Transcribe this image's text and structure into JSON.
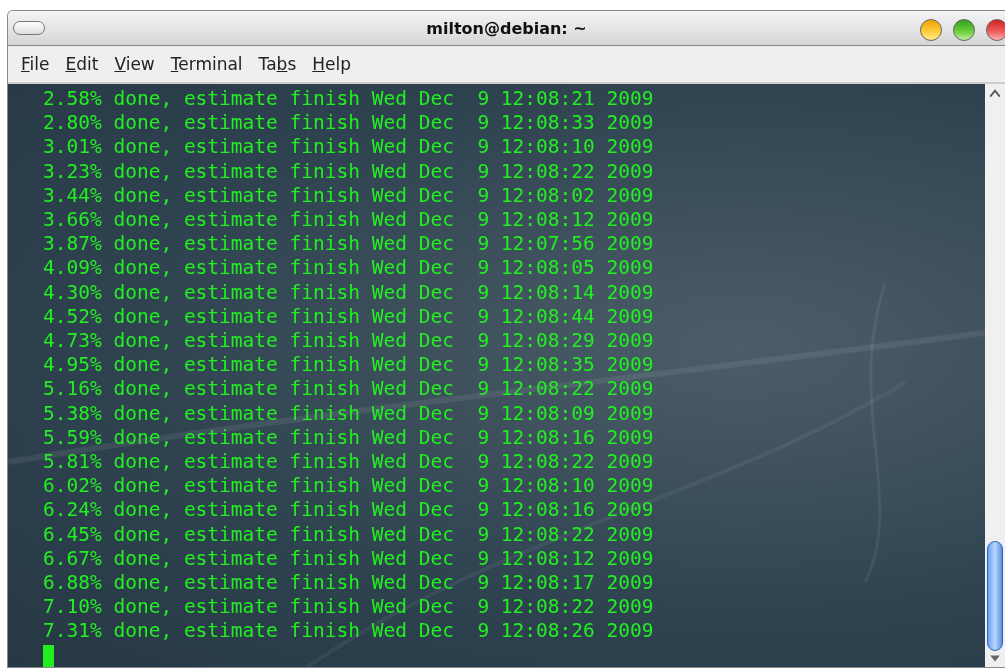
{
  "window": {
    "title": "milton@debian: ~"
  },
  "menu": [
    {
      "parts": [
        {
          "text": "F",
          "underlined": true
        },
        {
          "text": "ile",
          "underlined": false
        }
      ]
    },
    {
      "parts": [
        {
          "text": "E",
          "underlined": true
        },
        {
          "text": "dit",
          "underlined": false
        }
      ]
    },
    {
      "parts": [
        {
          "text": "V",
          "underlined": true
        },
        {
          "text": "iew",
          "underlined": false
        }
      ]
    },
    {
      "parts": [
        {
          "text": "T",
          "underlined": true
        },
        {
          "text": "erminal",
          "underlined": false
        }
      ]
    },
    {
      "parts": [
        {
          "text": "Ta",
          "underlined": false
        },
        {
          "text": "b",
          "underlined": true
        },
        {
          "text": "s",
          "underlined": false
        }
      ]
    },
    {
      "parts": [
        {
          "text": "H",
          "underlined": true
        },
        {
          "text": "elp",
          "underlined": false
        }
      ]
    }
  ],
  "terminal": {
    "lines": [
      "2.58% done, estimate finish Wed Dec  9 12:08:21 2009",
      "2.80% done, estimate finish Wed Dec  9 12:08:33 2009",
      "3.01% done, estimate finish Wed Dec  9 12:08:10 2009",
      "3.23% done, estimate finish Wed Dec  9 12:08:22 2009",
      "3.44% done, estimate finish Wed Dec  9 12:08:02 2009",
      "3.66% done, estimate finish Wed Dec  9 12:08:12 2009",
      "3.87% done, estimate finish Wed Dec  9 12:07:56 2009",
      "4.09% done, estimate finish Wed Dec  9 12:08:05 2009",
      "4.30% done, estimate finish Wed Dec  9 12:08:14 2009",
      "4.52% done, estimate finish Wed Dec  9 12:08:44 2009",
      "4.73% done, estimate finish Wed Dec  9 12:08:29 2009",
      "4.95% done, estimate finish Wed Dec  9 12:08:35 2009",
      "5.16% done, estimate finish Wed Dec  9 12:08:22 2009",
      "5.38% done, estimate finish Wed Dec  9 12:08:09 2009",
      "5.59% done, estimate finish Wed Dec  9 12:08:16 2009",
      "5.81% done, estimate finish Wed Dec  9 12:08:22 2009",
      "6.02% done, estimate finish Wed Dec  9 12:08:10 2009",
      "6.24% done, estimate finish Wed Dec  9 12:08:16 2009",
      "6.45% done, estimate finish Wed Dec  9 12:08:22 2009",
      "6.67% done, estimate finish Wed Dec  9 12:08:12 2009",
      "6.88% done, estimate finish Wed Dec  9 12:08:17 2009",
      "7.10% done, estimate finish Wed Dec  9 12:08:22 2009",
      "7.31% done, estimate finish Wed Dec  9 12:08:26 2009"
    ]
  }
}
